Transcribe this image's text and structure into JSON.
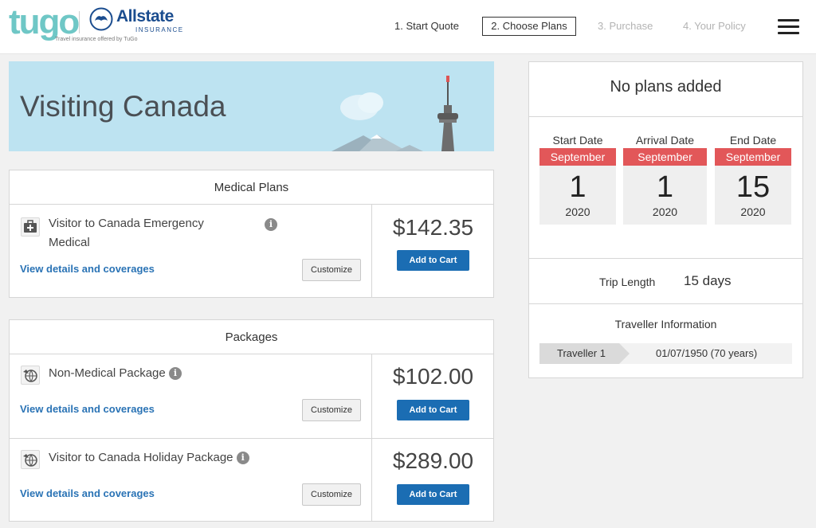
{
  "header": {
    "logo_tugo": "tugo",
    "logo_allstate": "Allstate",
    "logo_allstate_sub": "INSURANCE",
    "logo_tagline": "Travel insurance offered by TuGo",
    "steps": [
      {
        "label": "1. Start Quote",
        "state": "done"
      },
      {
        "label": "2. Choose Plans",
        "state": "active"
      },
      {
        "label": "3. Purchase",
        "state": "disabled"
      },
      {
        "label": "4. Your Policy",
        "state": "disabled"
      }
    ],
    "menu_icon": "hamburger-menu-icon"
  },
  "banner": {
    "title": "Visiting Canada",
    "background": "#bde3f1"
  },
  "medical": {
    "header": "Medical Plans",
    "plans": [
      {
        "name_line1": "Visitor to Canada Emergency",
        "name_line2": "Medical",
        "details_link": "View details and coverages",
        "customize": "Customize",
        "price": "$142.35",
        "add_to_cart": "Add to Cart",
        "icon": "medical-kit-icon"
      }
    ]
  },
  "packages": {
    "header": "Packages",
    "plans": [
      {
        "name": "Non-Medical Package",
        "details_link": "View details and coverages",
        "customize": "Customize",
        "price": "$102.00",
        "add_to_cart": "Add to Cart",
        "icon": "globe-plane-icon"
      },
      {
        "name": "Visitor to Canada Holiday Package",
        "details_link": "View details and coverages",
        "customize": "Customize",
        "price": "$289.00",
        "add_to_cart": "Add to Cart",
        "icon": "globe-plane-icon"
      }
    ]
  },
  "summary": {
    "no_plans": "No plans added",
    "dates": [
      {
        "label": "Start Date",
        "month": "September",
        "day": "1",
        "year": "2020"
      },
      {
        "label": "Arrival Date",
        "month": "September",
        "day": "1",
        "year": "2020"
      },
      {
        "label": "End Date",
        "month": "September",
        "day": "15",
        "year": "2020"
      }
    ],
    "trip_length_label": "Trip Length",
    "trip_length_value": "15 days",
    "traveller_title": "Traveller Information",
    "traveller_tag": "Traveller 1",
    "traveller_value": "01/07/1950 (70 years)"
  },
  "colors": {
    "primary_button": "#1b6db3",
    "link": "#2a73b5",
    "date_month": "#e25759",
    "tugo": "#6fc7c6",
    "allstate": "#1b4d8f"
  }
}
